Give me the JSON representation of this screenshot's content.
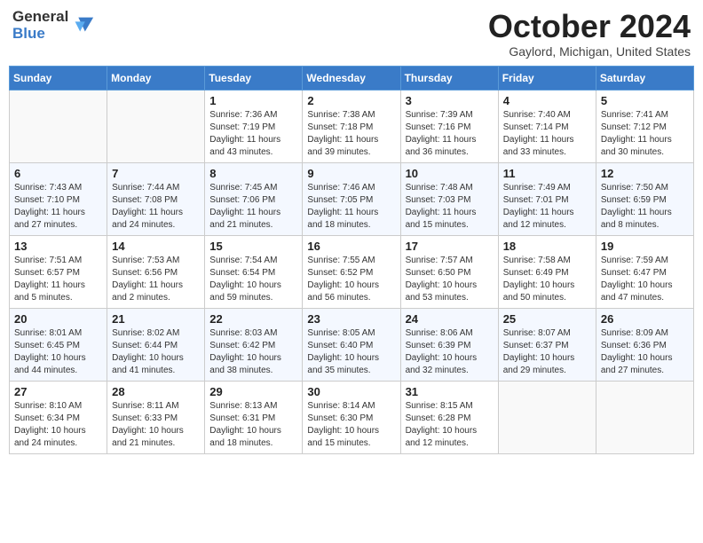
{
  "header": {
    "logo_line1": "General",
    "logo_line2": "Blue",
    "month": "October 2024",
    "location": "Gaylord, Michigan, United States"
  },
  "days_of_week": [
    "Sunday",
    "Monday",
    "Tuesday",
    "Wednesday",
    "Thursday",
    "Friday",
    "Saturday"
  ],
  "weeks": [
    [
      {
        "day": "",
        "sunrise": "",
        "sunset": "",
        "daylight": ""
      },
      {
        "day": "",
        "sunrise": "",
        "sunset": "",
        "daylight": ""
      },
      {
        "day": "1",
        "sunrise": "Sunrise: 7:36 AM",
        "sunset": "Sunset: 7:19 PM",
        "daylight": "Daylight: 11 hours and 43 minutes."
      },
      {
        "day": "2",
        "sunrise": "Sunrise: 7:38 AM",
        "sunset": "Sunset: 7:18 PM",
        "daylight": "Daylight: 11 hours and 39 minutes."
      },
      {
        "day": "3",
        "sunrise": "Sunrise: 7:39 AM",
        "sunset": "Sunset: 7:16 PM",
        "daylight": "Daylight: 11 hours and 36 minutes."
      },
      {
        "day": "4",
        "sunrise": "Sunrise: 7:40 AM",
        "sunset": "Sunset: 7:14 PM",
        "daylight": "Daylight: 11 hours and 33 minutes."
      },
      {
        "day": "5",
        "sunrise": "Sunrise: 7:41 AM",
        "sunset": "Sunset: 7:12 PM",
        "daylight": "Daylight: 11 hours and 30 minutes."
      }
    ],
    [
      {
        "day": "6",
        "sunrise": "Sunrise: 7:43 AM",
        "sunset": "Sunset: 7:10 PM",
        "daylight": "Daylight: 11 hours and 27 minutes."
      },
      {
        "day": "7",
        "sunrise": "Sunrise: 7:44 AM",
        "sunset": "Sunset: 7:08 PM",
        "daylight": "Daylight: 11 hours and 24 minutes."
      },
      {
        "day": "8",
        "sunrise": "Sunrise: 7:45 AM",
        "sunset": "Sunset: 7:06 PM",
        "daylight": "Daylight: 11 hours and 21 minutes."
      },
      {
        "day": "9",
        "sunrise": "Sunrise: 7:46 AM",
        "sunset": "Sunset: 7:05 PM",
        "daylight": "Daylight: 11 hours and 18 minutes."
      },
      {
        "day": "10",
        "sunrise": "Sunrise: 7:48 AM",
        "sunset": "Sunset: 7:03 PM",
        "daylight": "Daylight: 11 hours and 15 minutes."
      },
      {
        "day": "11",
        "sunrise": "Sunrise: 7:49 AM",
        "sunset": "Sunset: 7:01 PM",
        "daylight": "Daylight: 11 hours and 12 minutes."
      },
      {
        "day": "12",
        "sunrise": "Sunrise: 7:50 AM",
        "sunset": "Sunset: 6:59 PM",
        "daylight": "Daylight: 11 hours and 8 minutes."
      }
    ],
    [
      {
        "day": "13",
        "sunrise": "Sunrise: 7:51 AM",
        "sunset": "Sunset: 6:57 PM",
        "daylight": "Daylight: 11 hours and 5 minutes."
      },
      {
        "day": "14",
        "sunrise": "Sunrise: 7:53 AM",
        "sunset": "Sunset: 6:56 PM",
        "daylight": "Daylight: 11 hours and 2 minutes."
      },
      {
        "day": "15",
        "sunrise": "Sunrise: 7:54 AM",
        "sunset": "Sunset: 6:54 PM",
        "daylight": "Daylight: 10 hours and 59 minutes."
      },
      {
        "day": "16",
        "sunrise": "Sunrise: 7:55 AM",
        "sunset": "Sunset: 6:52 PM",
        "daylight": "Daylight: 10 hours and 56 minutes."
      },
      {
        "day": "17",
        "sunrise": "Sunrise: 7:57 AM",
        "sunset": "Sunset: 6:50 PM",
        "daylight": "Daylight: 10 hours and 53 minutes."
      },
      {
        "day": "18",
        "sunrise": "Sunrise: 7:58 AM",
        "sunset": "Sunset: 6:49 PM",
        "daylight": "Daylight: 10 hours and 50 minutes."
      },
      {
        "day": "19",
        "sunrise": "Sunrise: 7:59 AM",
        "sunset": "Sunset: 6:47 PM",
        "daylight": "Daylight: 10 hours and 47 minutes."
      }
    ],
    [
      {
        "day": "20",
        "sunrise": "Sunrise: 8:01 AM",
        "sunset": "Sunset: 6:45 PM",
        "daylight": "Daylight: 10 hours and 44 minutes."
      },
      {
        "day": "21",
        "sunrise": "Sunrise: 8:02 AM",
        "sunset": "Sunset: 6:44 PM",
        "daylight": "Daylight: 10 hours and 41 minutes."
      },
      {
        "day": "22",
        "sunrise": "Sunrise: 8:03 AM",
        "sunset": "Sunset: 6:42 PM",
        "daylight": "Daylight: 10 hours and 38 minutes."
      },
      {
        "day": "23",
        "sunrise": "Sunrise: 8:05 AM",
        "sunset": "Sunset: 6:40 PM",
        "daylight": "Daylight: 10 hours and 35 minutes."
      },
      {
        "day": "24",
        "sunrise": "Sunrise: 8:06 AM",
        "sunset": "Sunset: 6:39 PM",
        "daylight": "Daylight: 10 hours and 32 minutes."
      },
      {
        "day": "25",
        "sunrise": "Sunrise: 8:07 AM",
        "sunset": "Sunset: 6:37 PM",
        "daylight": "Daylight: 10 hours and 29 minutes."
      },
      {
        "day": "26",
        "sunrise": "Sunrise: 8:09 AM",
        "sunset": "Sunset: 6:36 PM",
        "daylight": "Daylight: 10 hours and 27 minutes."
      }
    ],
    [
      {
        "day": "27",
        "sunrise": "Sunrise: 8:10 AM",
        "sunset": "Sunset: 6:34 PM",
        "daylight": "Daylight: 10 hours and 24 minutes."
      },
      {
        "day": "28",
        "sunrise": "Sunrise: 8:11 AM",
        "sunset": "Sunset: 6:33 PM",
        "daylight": "Daylight: 10 hours and 21 minutes."
      },
      {
        "day": "29",
        "sunrise": "Sunrise: 8:13 AM",
        "sunset": "Sunset: 6:31 PM",
        "daylight": "Daylight: 10 hours and 18 minutes."
      },
      {
        "day": "30",
        "sunrise": "Sunrise: 8:14 AM",
        "sunset": "Sunset: 6:30 PM",
        "daylight": "Daylight: 10 hours and 15 minutes."
      },
      {
        "day": "31",
        "sunrise": "Sunrise: 8:15 AM",
        "sunset": "Sunset: 6:28 PM",
        "daylight": "Daylight: 10 hours and 12 minutes."
      },
      {
        "day": "",
        "sunrise": "",
        "sunset": "",
        "daylight": ""
      },
      {
        "day": "",
        "sunrise": "",
        "sunset": "",
        "daylight": ""
      }
    ]
  ]
}
